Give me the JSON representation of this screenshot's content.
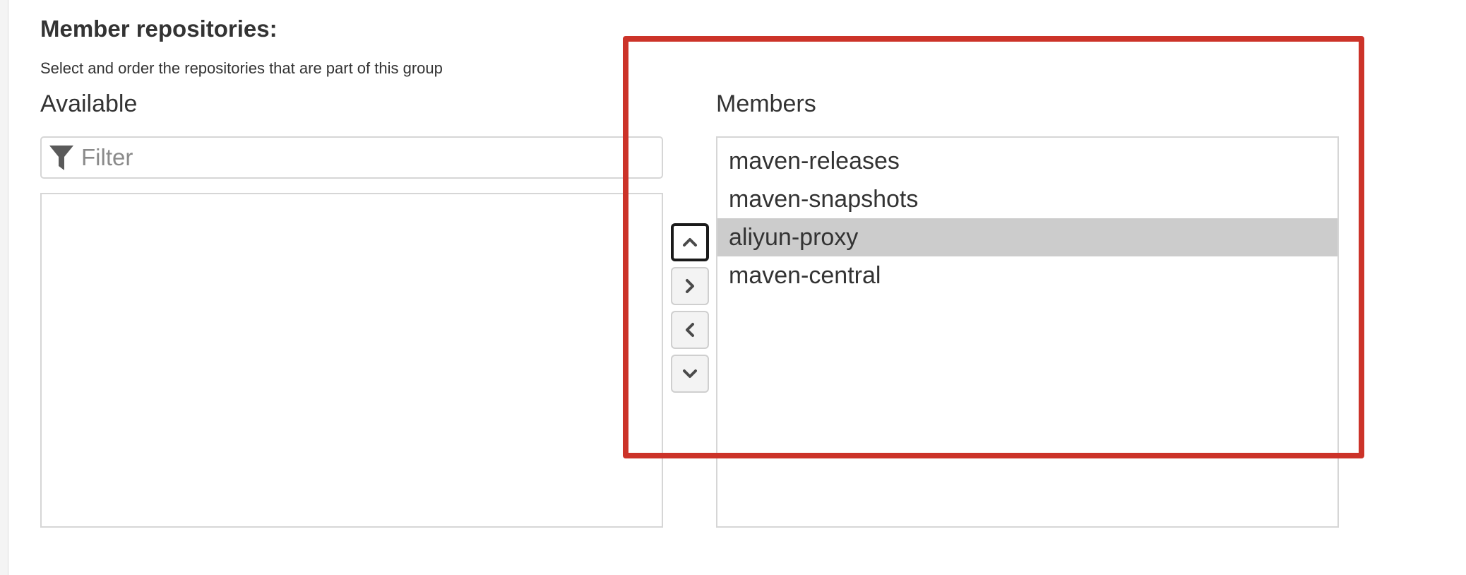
{
  "section": {
    "title": "Member repositories:",
    "help_text": "Select and order the repositories that are part of this group"
  },
  "available": {
    "heading": "Available",
    "filter_placeholder": "Filter",
    "filter_value": "",
    "items": []
  },
  "members": {
    "heading": "Members",
    "items": [
      {
        "label": "maven-releases",
        "selected": false
      },
      {
        "label": "maven-snapshots",
        "selected": false
      },
      {
        "label": "aliyun-proxy",
        "selected": true
      },
      {
        "label": "maven-central",
        "selected": false
      }
    ]
  },
  "controls": {
    "buttons": [
      {
        "name": "move-up-button",
        "icon": "chevron-up-icon",
        "focused": true
      },
      {
        "name": "add-to-members-button",
        "icon": "chevron-right-icon",
        "focused": false
      },
      {
        "name": "remove-from-members-button",
        "icon": "chevron-left-icon",
        "focused": false
      },
      {
        "name": "move-down-button",
        "icon": "chevron-down-icon",
        "focused": false
      }
    ]
  },
  "colors": {
    "selected_row": "#cccccc",
    "highlight_annotation": "#cc3329",
    "text": "#333333",
    "border": "#d6d6d6"
  }
}
